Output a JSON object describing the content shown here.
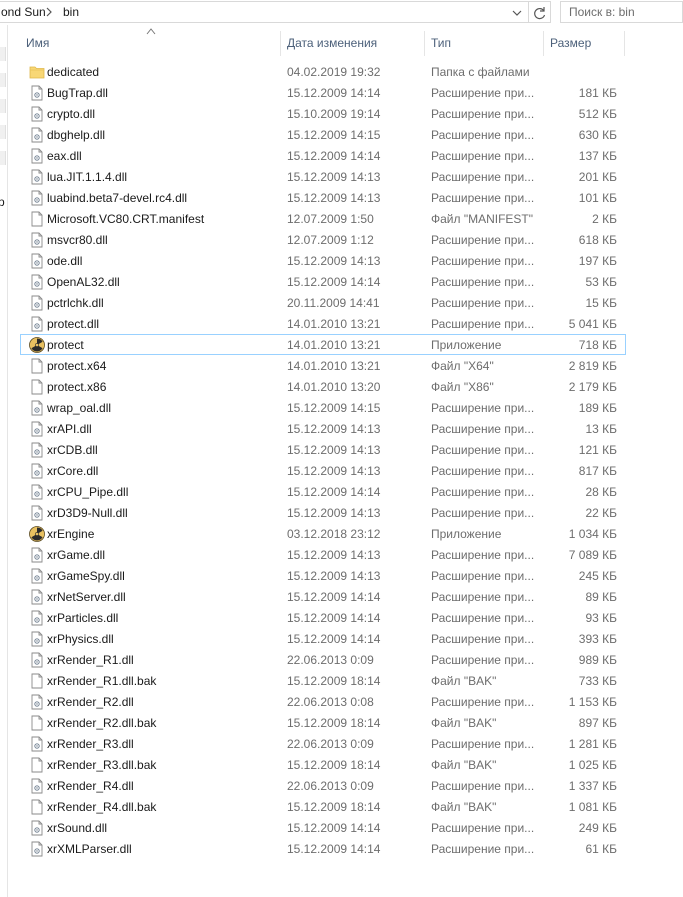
{
  "address_bar": {
    "crumbs": [
      "ond Sun",
      "bin"
    ],
    "search_placeholder": "Поиск в: bin"
  },
  "nav": {
    "partial_label": "р"
  },
  "columns": {
    "name": "Имя",
    "date": "Дата изменения",
    "type": "Тип",
    "size": "Размер"
  },
  "files": [
    {
      "name": "dedicated",
      "date": "04.02.2019 19:32",
      "type": "Папка с файлами",
      "size": "",
      "icon": "folder-icon"
    },
    {
      "name": "BugTrap.dll",
      "date": "15.12.2009 14:14",
      "type": "Расширение при...",
      "size": "181 КБ",
      "icon": "dll-file-icon"
    },
    {
      "name": "crypto.dll",
      "date": "15.10.2009 19:14",
      "type": "Расширение при...",
      "size": "512 КБ",
      "icon": "dll-file-icon"
    },
    {
      "name": "dbghelp.dll",
      "date": "15.12.2009 14:15",
      "type": "Расширение при...",
      "size": "630 КБ",
      "icon": "dll-file-icon"
    },
    {
      "name": "eax.dll",
      "date": "15.12.2009 14:14",
      "type": "Расширение при...",
      "size": "137 КБ",
      "icon": "dll-file-icon"
    },
    {
      "name": "lua.JIT.1.1.4.dll",
      "date": "15.12.2009 14:13",
      "type": "Расширение при...",
      "size": "201 КБ",
      "icon": "dll-file-icon"
    },
    {
      "name": "luabind.beta7-devel.rc4.dll",
      "date": "15.12.2009 14:13",
      "type": "Расширение при...",
      "size": "101 КБ",
      "icon": "dll-file-icon"
    },
    {
      "name": "Microsoft.VC80.CRT.manifest",
      "date": "12.07.2009 1:50",
      "type": "Файл \"MANIFEST\"",
      "size": "2 КБ",
      "icon": "file-icon"
    },
    {
      "name": "msvcr80.dll",
      "date": "12.07.2009 1:12",
      "type": "Расширение при...",
      "size": "618 КБ",
      "icon": "dll-file-icon"
    },
    {
      "name": "ode.dll",
      "date": "15.12.2009 14:13",
      "type": "Расширение при...",
      "size": "197 КБ",
      "icon": "dll-file-icon"
    },
    {
      "name": "OpenAL32.dll",
      "date": "15.12.2009 14:14",
      "type": "Расширение при...",
      "size": "53 КБ",
      "icon": "dll-file-icon"
    },
    {
      "name": "pctrlchk.dll",
      "date": "20.11.2009 14:41",
      "type": "Расширение при...",
      "size": "15 КБ",
      "icon": "dll-file-icon"
    },
    {
      "name": "protect.dll",
      "date": "14.01.2010 13:21",
      "type": "Расширение при...",
      "size": "5 041 КБ",
      "icon": "dll-file-icon"
    },
    {
      "name": "protect",
      "date": "14.01.2010 13:21",
      "type": "Приложение",
      "size": "718 КБ",
      "icon": "radiation-app-icon",
      "selected": true
    },
    {
      "name": "protect.x64",
      "date": "14.01.2010 13:21",
      "type": "Файл \"X64\"",
      "size": "2 819 КБ",
      "icon": "file-icon"
    },
    {
      "name": "protect.x86",
      "date": "14.01.2010 13:20",
      "type": "Файл \"X86\"",
      "size": "2 179 КБ",
      "icon": "file-icon"
    },
    {
      "name": "wrap_oal.dll",
      "date": "15.12.2009 14:15",
      "type": "Расширение при...",
      "size": "189 КБ",
      "icon": "dll-file-icon"
    },
    {
      "name": "xrAPI.dll",
      "date": "15.12.2009 14:13",
      "type": "Расширение при...",
      "size": "13 КБ",
      "icon": "dll-file-icon"
    },
    {
      "name": "xrCDB.dll",
      "date": "15.12.2009 14:13",
      "type": "Расширение при...",
      "size": "121 КБ",
      "icon": "dll-file-icon"
    },
    {
      "name": "xrCore.dll",
      "date": "15.12.2009 14:13",
      "type": "Расширение при...",
      "size": "817 КБ",
      "icon": "dll-file-icon"
    },
    {
      "name": "xrCPU_Pipe.dll",
      "date": "15.12.2009 14:14",
      "type": "Расширение при...",
      "size": "28 КБ",
      "icon": "dll-file-icon"
    },
    {
      "name": "xrD3D9-Null.dll",
      "date": "15.12.2009 14:13",
      "type": "Расширение при...",
      "size": "22 КБ",
      "icon": "dll-file-icon"
    },
    {
      "name": "xrEngine",
      "date": "03.12.2018 23:12",
      "type": "Приложение",
      "size": "1 034 КБ",
      "icon": "radiation-app-icon"
    },
    {
      "name": "xrGame.dll",
      "date": "15.12.2009 14:13",
      "type": "Расширение при...",
      "size": "7 089 КБ",
      "icon": "dll-file-icon"
    },
    {
      "name": "xrGameSpy.dll",
      "date": "15.12.2009 14:13",
      "type": "Расширение при...",
      "size": "245 КБ",
      "icon": "dll-file-icon"
    },
    {
      "name": "xrNetServer.dll",
      "date": "15.12.2009 14:14",
      "type": "Расширение при...",
      "size": "89 КБ",
      "icon": "dll-file-icon"
    },
    {
      "name": "xrParticles.dll",
      "date": "15.12.2009 14:14",
      "type": "Расширение при...",
      "size": "93 КБ",
      "icon": "dll-file-icon"
    },
    {
      "name": "xrPhysics.dll",
      "date": "15.12.2009 14:14",
      "type": "Расширение при...",
      "size": "393 КБ",
      "icon": "dll-file-icon"
    },
    {
      "name": "xrRender_R1.dll",
      "date": "22.06.2013 0:09",
      "type": "Расширение при...",
      "size": "989 КБ",
      "icon": "dll-file-icon"
    },
    {
      "name": "xrRender_R1.dll.bak",
      "date": "15.12.2009 18:14",
      "type": "Файл \"BAK\"",
      "size": "733 КБ",
      "icon": "file-icon"
    },
    {
      "name": "xrRender_R2.dll",
      "date": "22.06.2013 0:08",
      "type": "Расширение при...",
      "size": "1 153 КБ",
      "icon": "dll-file-icon"
    },
    {
      "name": "xrRender_R2.dll.bak",
      "date": "15.12.2009 18:14",
      "type": "Файл \"BAK\"",
      "size": "897 КБ",
      "icon": "file-icon"
    },
    {
      "name": "xrRender_R3.dll",
      "date": "22.06.2013 0:09",
      "type": "Расширение при...",
      "size": "1 281 КБ",
      "icon": "dll-file-icon"
    },
    {
      "name": "xrRender_R3.dll.bak",
      "date": "15.12.2009 18:14",
      "type": "Файл \"BAK\"",
      "size": "1 025 КБ",
      "icon": "file-icon"
    },
    {
      "name": "xrRender_R4.dll",
      "date": "22.06.2013 0:09",
      "type": "Расширение при...",
      "size": "1 337 КБ",
      "icon": "dll-file-icon"
    },
    {
      "name": "xrRender_R4.dll.bak",
      "date": "15.12.2009 18:14",
      "type": "Файл \"BAK\"",
      "size": "1 081 КБ",
      "icon": "file-icon"
    },
    {
      "name": "xrSound.dll",
      "date": "15.12.2009 14:14",
      "type": "Расширение при...",
      "size": "249 КБ",
      "icon": "dll-file-icon"
    },
    {
      "name": "xrXMLParser.dll",
      "date": "15.12.2009 14:14",
      "type": "Расширение при...",
      "size": "61 КБ",
      "icon": "dll-file-icon"
    }
  ],
  "colors": {
    "header_text": "#4c607a",
    "selection_border": "#99d1ff",
    "secondary_text": "#6d6d6d",
    "folder_yellow": "#f8d775"
  }
}
